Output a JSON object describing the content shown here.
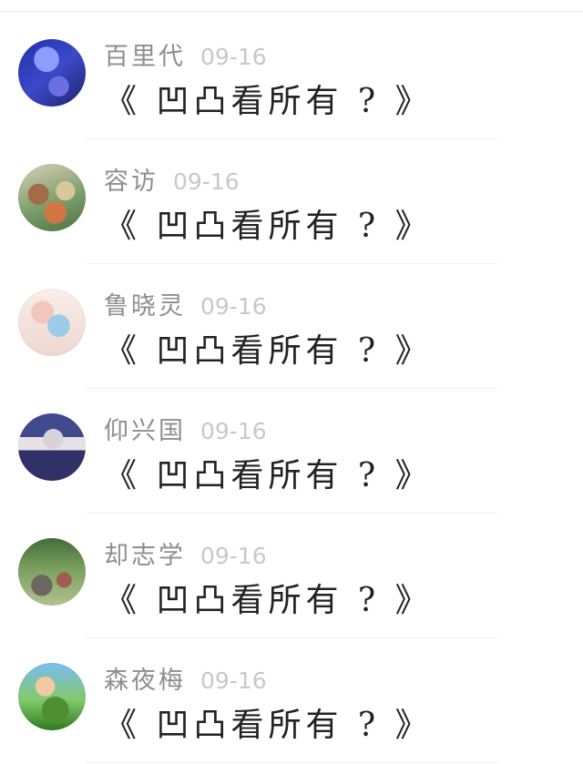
{
  "items": [
    {
      "avatar": "avatar-icon",
      "name": "百里代",
      "date": "09-16",
      "message": "《 凹凸看所有 ? 》"
    },
    {
      "avatar": "avatar-icon",
      "name": "容访",
      "date": "09-16",
      "message": "《 凹凸看所有 ? 》"
    },
    {
      "avatar": "avatar-icon",
      "name": "鲁晓灵",
      "date": "09-16",
      "message": "《 凹凸看所有 ? 》"
    },
    {
      "avatar": "avatar-icon",
      "name": "仰兴国",
      "date": "09-16",
      "message": "《 凹凸看所有 ? 》"
    },
    {
      "avatar": "avatar-icon",
      "name": "却志学",
      "date": "09-16",
      "message": "《 凹凸看所有 ? 》"
    },
    {
      "avatar": "avatar-icon",
      "name": "森夜梅",
      "date": "09-16",
      "message": "《 凹凸看所有 ? 》"
    }
  ]
}
